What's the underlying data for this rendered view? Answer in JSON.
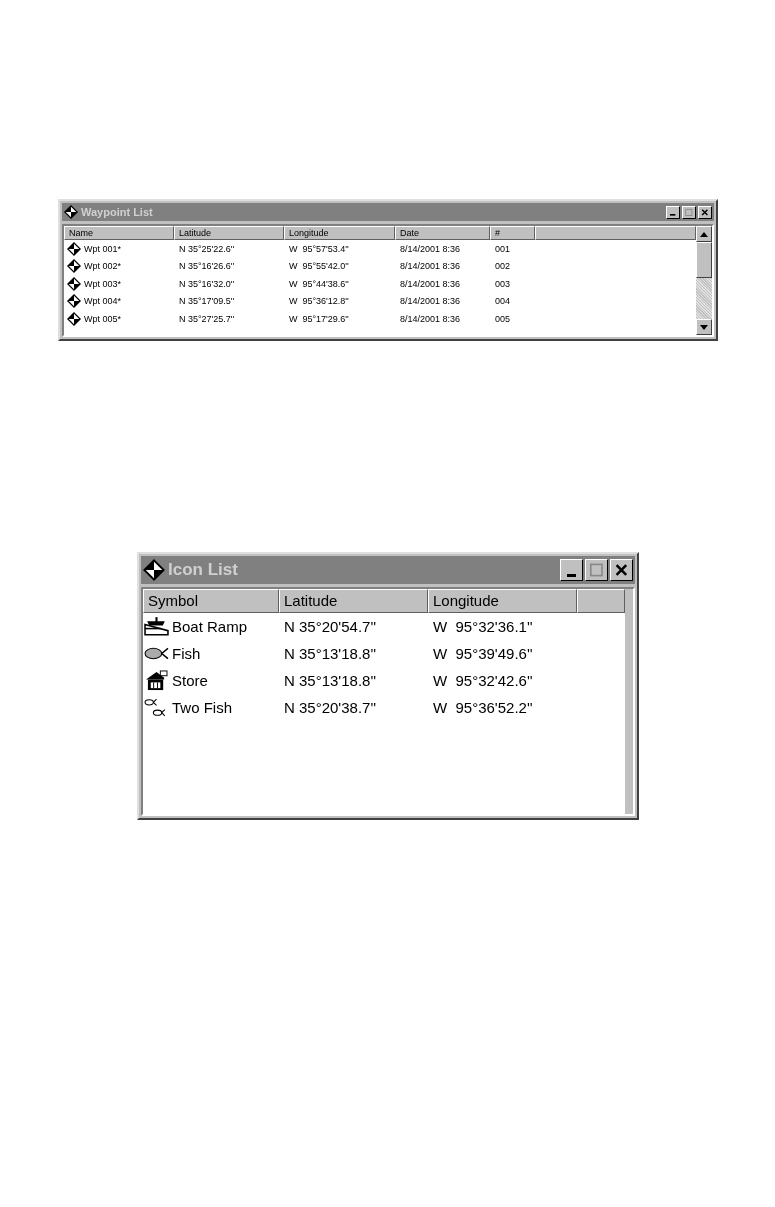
{
  "waypoint_list": {
    "title": "Waypoint List",
    "columns": [
      "Name",
      "Latitude",
      "Longitude",
      "Date",
      "#"
    ],
    "rows": [
      {
        "name": "Wpt 001*",
        "latitude": "N 35°25'22.6''",
        "longitude": "W  95°57'53.4''",
        "date": "8/14/2001 8:36",
        "number": "001"
      },
      {
        "name": "Wpt 002*",
        "latitude": "N 35°16'26.6''",
        "longitude": "W  95°55'42.0''",
        "date": "8/14/2001 8:36",
        "number": "002"
      },
      {
        "name": "Wpt 003*",
        "latitude": "N 35°16'32.0''",
        "longitude": "W  95°44'38.6''",
        "date": "8/14/2001 8:36",
        "number": "003"
      },
      {
        "name": "Wpt 004*",
        "latitude": "N 35°17'09.5''",
        "longitude": "W  95°36'12.8''",
        "date": "8/14/2001 8:36",
        "number": "004"
      },
      {
        "name": "Wpt 005*",
        "latitude": "N 35°27'25.7''",
        "longitude": "W  95°17'29.6''",
        "date": "8/14/2001 8:36",
        "number": "005"
      }
    ]
  },
  "icon_list": {
    "title": "Icon List",
    "columns": [
      "Symbol",
      "Latitude",
      "Longitude"
    ],
    "rows": [
      {
        "kind": "ramp",
        "symbol": "Boat Ramp",
        "latitude": "N 35°20'54.7''",
        "longitude": "W  95°32'36.1''"
      },
      {
        "kind": "fish",
        "symbol": "Fish",
        "latitude": "N 35°13'18.8''",
        "longitude": "W  95°39'49.6''"
      },
      {
        "kind": "store",
        "symbol": "Store",
        "latitude": "N 35°13'18.8''",
        "longitude": "W  95°32'42.6''"
      },
      {
        "kind": "twofish",
        "symbol": "Two Fish",
        "latitude": "N 35°20'38.7''",
        "longitude": "W  95°36'52.2''"
      }
    ]
  }
}
